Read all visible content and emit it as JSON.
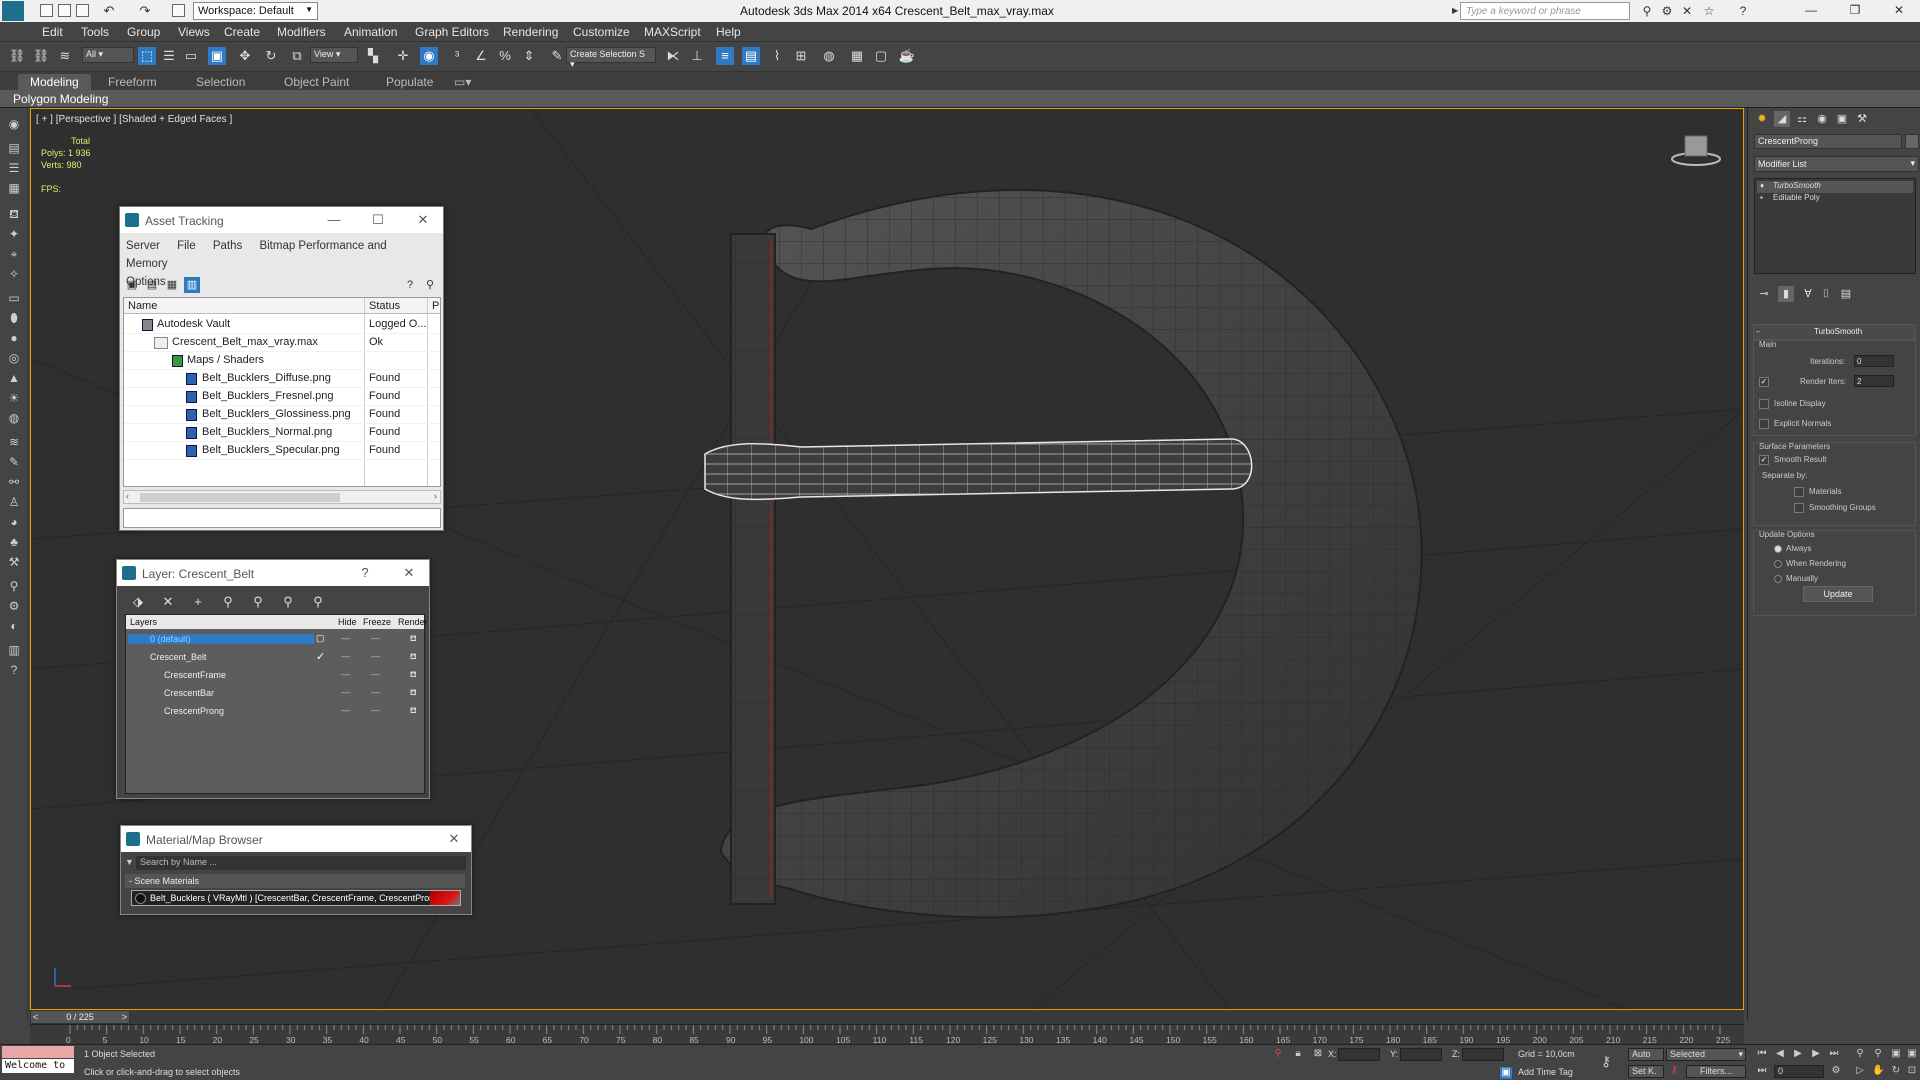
{
  "app": {
    "title": "Autodesk 3ds Max  2014 x64     Crescent_Belt_max_vray.max",
    "workspace": "Workspace: Default",
    "search_placeholder": "Type a keyword or phrase"
  },
  "menu": [
    "Edit",
    "Tools",
    "Group",
    "Views",
    "Create",
    "Modifiers",
    "Animation",
    "Graph Editors",
    "Rendering",
    "Customize",
    "MAXScript",
    "Help"
  ],
  "toolbar": {
    "selection_filter": "All",
    "ref_coord": "View",
    "named_selection": "Create Selection S"
  },
  "ribbon": {
    "tabs": [
      "Modeling",
      "Freeform",
      "Selection",
      "Object Paint",
      "Populate"
    ],
    "active_tab": "Modeling",
    "panel": "Polygon Modeling"
  },
  "viewport": {
    "label": "[ + ] [Perspective ] [Shaded + Edged Faces ]",
    "stats_header": "Total",
    "polys_label": "Polys:",
    "polys_value": "1 936",
    "verts_label": "Verts:",
    "verts_value": "980",
    "fps_label": "FPS:"
  },
  "asset_tracking": {
    "title": "Asset Tracking",
    "menu": [
      "Server",
      "File",
      "Paths",
      "Bitmap Performance and Memory"
    ],
    "menu2": "Options",
    "columns": {
      "name": "Name",
      "status": "Status",
      "extra": "P"
    },
    "rows": [
      {
        "name": "Autodesk Vault",
        "status": "Logged O..."
      },
      {
        "name": "Crescent_Belt_max_vray.max",
        "status": "Ok"
      },
      {
        "name": "Maps / Shaders",
        "status": ""
      },
      {
        "name": "Belt_Bucklers_Diffuse.png",
        "status": "Found"
      },
      {
        "name": "Belt_Bucklers_Fresnel.png",
        "status": "Found"
      },
      {
        "name": "Belt_Bucklers_Glossiness.png",
        "status": "Found"
      },
      {
        "name": "Belt_Bucklers_Normal.png",
        "status": "Found"
      },
      {
        "name": "Belt_Bucklers_Specular.png",
        "status": "Found"
      }
    ]
  },
  "layer_dialog": {
    "title": "Layer: Crescent_Belt",
    "help": "?",
    "columns": {
      "layers": "Layers",
      "hide": "Hide",
      "freeze": "Freeze",
      "render": "Render"
    },
    "rows": [
      {
        "name": "0 (default)"
      },
      {
        "name": "Crescent_Belt"
      },
      {
        "name": "CrescentFrame"
      },
      {
        "name": "CrescentBar"
      },
      {
        "name": "CrescentProng"
      }
    ]
  },
  "material_browser": {
    "title": "Material/Map Browser",
    "search_placeholder": "Search by Name ...",
    "section": "- Scene Materials",
    "material": "Belt_Bucklers  ( VRayMtl )  [CrescentBar, CrescentFrame, CrescentProng]"
  },
  "command_panel": {
    "object_name": "CrescentProng",
    "modifier_list": "Modifier List",
    "stack": [
      "TurboSmooth",
      "Editable Poly"
    ],
    "rollout_title": "TurboSmooth",
    "main_label": "Main",
    "iterations_label": "Iterations:",
    "iterations_value": "0",
    "render_iters_label": "Render Iters:",
    "render_iters_value": "2",
    "isoline": "Isoline Display",
    "explicit_normals": "Explicit Normals",
    "surface_params": "Surface Parameters",
    "smooth_result": "Smooth Result",
    "separate_by": "Separate by:",
    "materials": "Materials",
    "smoothing_groups": "Smoothing Groups",
    "update_options": "Update Options",
    "always": "Always",
    "when_rendering": "When Rendering",
    "manually": "Manually",
    "update_button": "Update"
  },
  "timeline": {
    "slider_label": "0 / 225",
    "ticks": [
      "0",
      "5",
      "10",
      "15",
      "20",
      "25",
      "30",
      "35",
      "40",
      "45",
      "50",
      "55",
      "60",
      "65",
      "70",
      "75",
      "80",
      "85",
      "90",
      "95",
      "100",
      "105",
      "110",
      "115",
      "120",
      "125",
      "130",
      "135",
      "140",
      "145",
      "150",
      "155",
      "160",
      "165",
      "170",
      "175",
      "180",
      "185",
      "190",
      "195",
      "200",
      "205",
      "210",
      "215",
      "220",
      "225"
    ]
  },
  "status": {
    "maxscript": "Welcome to",
    "selection": "1 Object Selected",
    "prompt": "Click or click-and-drag to select objects",
    "x_label": "X:",
    "y_label": "Y:",
    "z_label": "Z:",
    "grid": "Grid = 10,0cm",
    "add_time_tag": "Add Time Tag",
    "auto": "Auto",
    "selected": "Selected",
    "setk": "Set K.",
    "filters": "Filters...",
    "frame": "0"
  }
}
